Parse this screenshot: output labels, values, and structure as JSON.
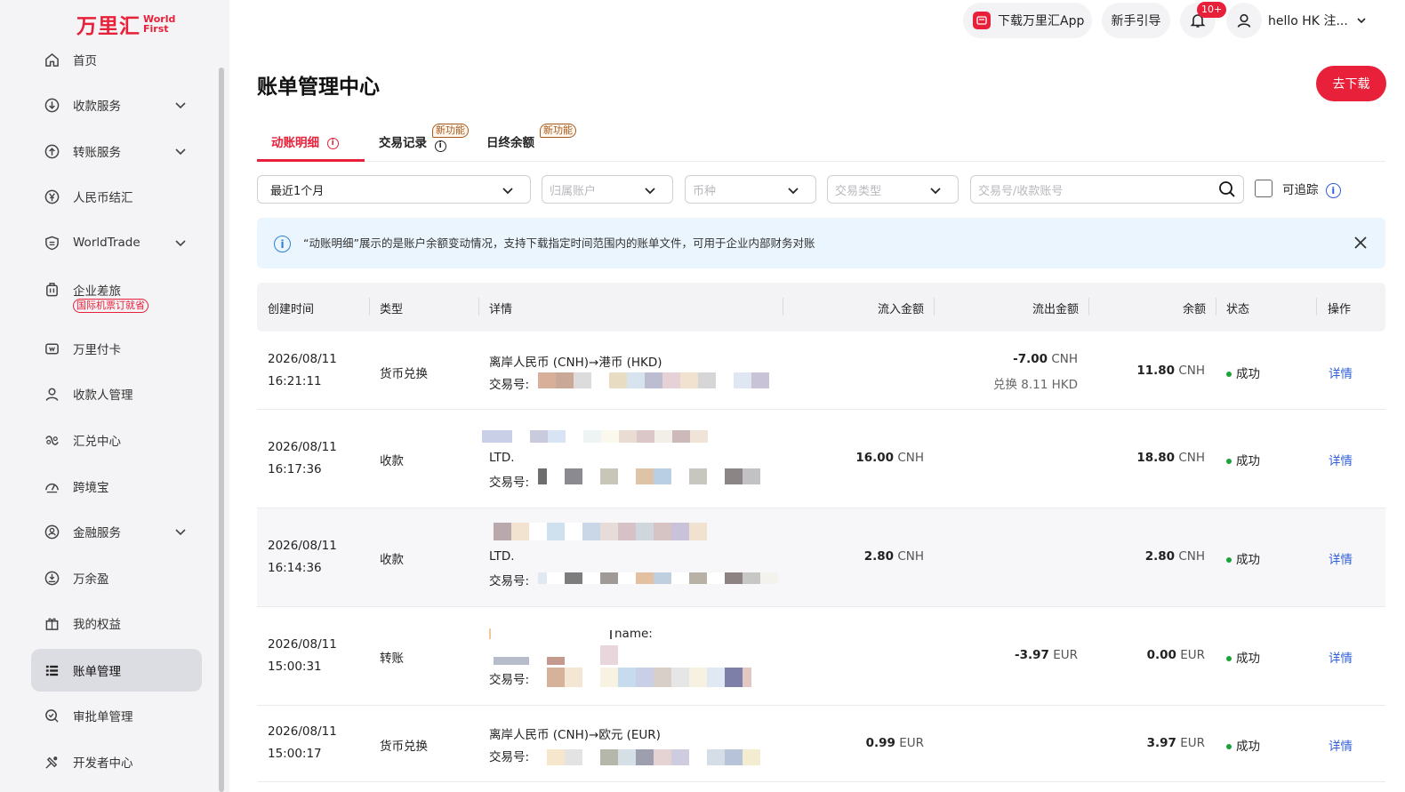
{
  "brand": {
    "name_cn": "万里汇",
    "name_en_1": "World",
    "name_en_2": "First"
  },
  "sidebar": {
    "items": [
      {
        "label": "首页",
        "icon": "home-icon"
      },
      {
        "label": "收款服务",
        "icon": "receive-icon",
        "expandable": true
      },
      {
        "label": "转账服务",
        "icon": "transfer-icon",
        "expandable": true
      },
      {
        "label": "人民币结汇",
        "icon": "rmb-icon"
      },
      {
        "label": "WorldTrade",
        "icon": "shield-icon",
        "expandable": true
      },
      {
        "label": "企业差旅",
        "icon": "luggage-icon",
        "badge": "国际机票订就省"
      },
      {
        "label": "万里付卡",
        "icon": "card-icon"
      },
      {
        "label": "收款人管理",
        "icon": "user-icon"
      },
      {
        "label": "汇兑中心",
        "icon": "exchange-icon"
      },
      {
        "label": "跨境宝",
        "icon": "gauge-icon"
      },
      {
        "label": "金融服务",
        "icon": "finance-icon",
        "expandable": true
      },
      {
        "label": "万余盈",
        "icon": "wallet-icon"
      },
      {
        "label": "我的权益",
        "icon": "gift-icon"
      },
      {
        "label": "账单管理",
        "icon": "list-icon",
        "active": true
      },
      {
        "label": "审批单管理",
        "icon": "approval-icon"
      },
      {
        "label": "开发者中心",
        "icon": "developer-icon"
      }
    ]
  },
  "header": {
    "download_app": "下载万里汇App",
    "guide": "新手引导",
    "notif_count": "10+",
    "user": "hello HK 注..."
  },
  "page": {
    "title": "账单管理中心",
    "download_button": "去下载"
  },
  "tabs": [
    {
      "label": "动账明细",
      "active": true
    },
    {
      "label": "交易记录",
      "tag": "新功能"
    },
    {
      "label": "日终余额",
      "tag": "新功能"
    }
  ],
  "filters": {
    "period": "最近1个月",
    "account_placeholder": "归属账户",
    "currency_placeholder": "币种",
    "type_placeholder": "交易类型",
    "search_placeholder": "交易号/收款账号",
    "traceable_label": "可追踪"
  },
  "banner": {
    "text": "“动账明细”展示的是账户余额变动情况，支持下载指定时间范围内的账单文件，可用于企业内部财务对账"
  },
  "table": {
    "columns": [
      "创建时间",
      "类型",
      "详情",
      "流入金额",
      "流出金额",
      "余额",
      "状态",
      "操作"
    ],
    "rows": [
      {
        "date": "2026/08/11",
        "time": "16:21:11",
        "type": "货币兑换",
        "detail": "离岸人民币 (CNH)→港币 (HKD)",
        "txn_label": "交易号:",
        "inflow": "",
        "inflow_cur": "",
        "outflow": "-7.00",
        "outflow_cur": "CNH",
        "outflow_sub": "兑换 8.11 HKD",
        "balance": "11.80",
        "balance_cur": "CNH",
        "status": "成功",
        "action": "详情"
      },
      {
        "date": "2026/08/11",
        "time": "16:17:36",
        "type": "收款",
        "detail": "LTD.",
        "txn_label": "交易号:",
        "inflow": "16.00",
        "inflow_cur": "CNH",
        "outflow": "",
        "outflow_cur": "",
        "outflow_sub": "",
        "balance": "18.80",
        "balance_cur": "CNH",
        "status": "成功",
        "action": "详情"
      },
      {
        "date": "2026/08/11",
        "time": "16:14:36",
        "type": "收款",
        "detail": "LTD.",
        "txn_label": "交易号:",
        "inflow": "2.80",
        "inflow_cur": "CNH",
        "outflow": "",
        "outflow_cur": "",
        "outflow_sub": "",
        "balance": "2.80",
        "balance_cur": "CNH",
        "status": "成功",
        "action": "详情"
      },
      {
        "date": "2026/08/11",
        "time": "15:00:31",
        "type": "转账",
        "detail": "name:",
        "txn_label": "交易号:",
        "inflow": "",
        "inflow_cur": "",
        "outflow": "-3.97",
        "outflow_cur": "EUR",
        "outflow_sub": "",
        "balance": "0.00",
        "balance_cur": "EUR",
        "status": "成功",
        "action": "详情"
      },
      {
        "date": "2026/08/11",
        "time": "15:00:17",
        "type": "货币兑换",
        "detail": "离岸人民币 (CNH)→欧元 (EUR)",
        "txn_label": "交易号:",
        "inflow": "0.99",
        "inflow_cur": "EUR",
        "outflow": "",
        "outflow_cur": "",
        "outflow_sub": "",
        "balance": "3.97",
        "balance_cur": "EUR",
        "status": "成功",
        "action": "详情"
      }
    ]
  },
  "colors": {
    "brand_red": "#e8203a",
    "success_green": "#1aa339",
    "link_blue": "#2f5fd8",
    "new_tag": "#a65a1d"
  }
}
